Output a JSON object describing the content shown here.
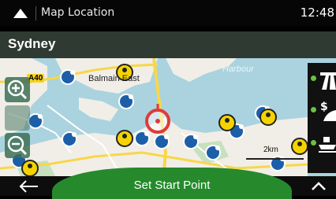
{
  "status_bar": {
    "title": "Map Location",
    "time": "12:48"
  },
  "city_bar": {
    "city": "Sydney"
  },
  "map": {
    "labels": {
      "suburb": "Balmain East",
      "water": "Harbour",
      "road_shield": "A40",
      "scale": "2km"
    },
    "colors": {
      "water": "#aad3df",
      "land": "#f1eee8",
      "road": "#f7d748",
      "accent_green": "#268a2d"
    }
  },
  "controls": {
    "zoom_in_icon": "zoom-in-icon",
    "zoom_out_icon": "zoom-out-icon",
    "categories": [
      "highway-icon",
      "fuel-price-icon",
      "ferry-icon"
    ]
  },
  "bottom_bar": {
    "set_start_label": "Set Start Point"
  }
}
